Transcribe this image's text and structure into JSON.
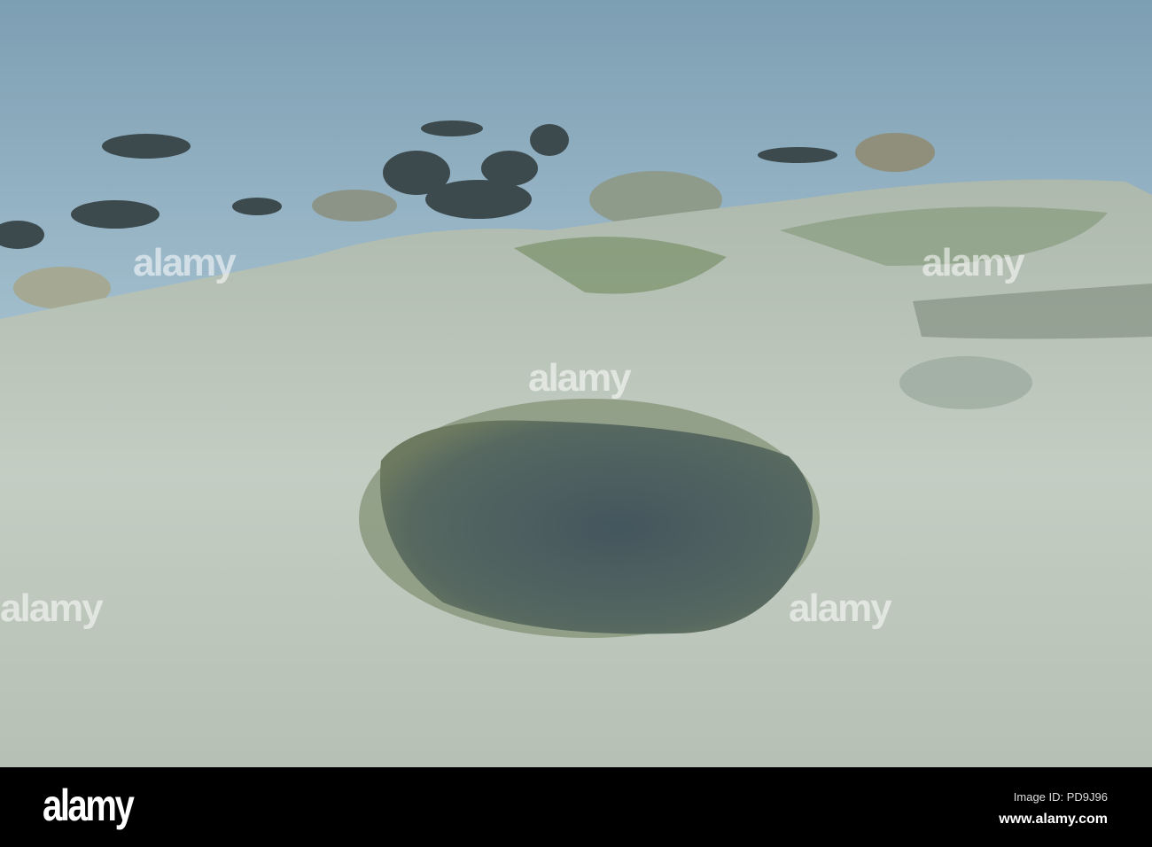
{
  "watermark": {
    "logo": "alamy",
    "image_id": "Image ID: PD9J96",
    "url": "www.alamy.com"
  },
  "colors": {
    "sea": "#8fb0c2",
    "rock": "#bcc7bb",
    "pool": "#4b5e66",
    "moss": "#5f7a4a"
  }
}
